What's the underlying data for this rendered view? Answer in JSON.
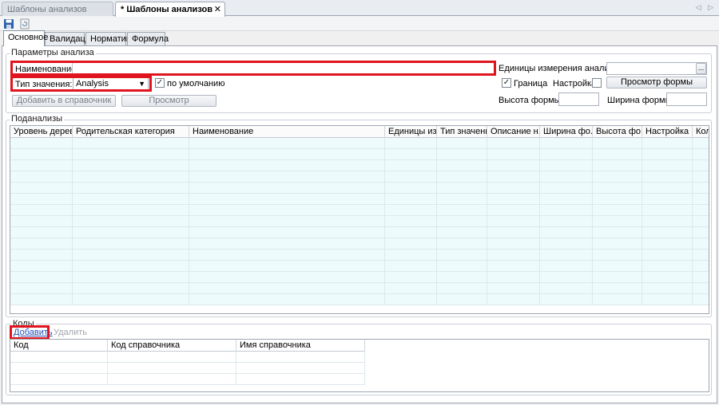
{
  "doc_tabs": {
    "inactive_title": "Шаблоны анализов",
    "active_title": "* Шаблоны анализов (нов...",
    "close_glyph": "✕",
    "scroll_glyph": "◁ ▷"
  },
  "toolbar": {
    "save_icon": "save-icon",
    "refresh_icon": "refresh-document-icon"
  },
  "form_tabs": [
    {
      "label": "Основное",
      "active": true
    },
    {
      "label": "Валидация",
      "active": false
    },
    {
      "label": "Норматив",
      "active": false
    },
    {
      "label": "Формула",
      "active": false
    }
  ],
  "params": {
    "group_title": "Параметры анализа",
    "name_label": "Наименование:",
    "name_value": "",
    "value_type_label": "Тип значения:",
    "value_type_selected": "Analysis",
    "default_label": "по умолчанию",
    "default_checked": true,
    "check_glyph": "✓",
    "add_to_dict_label": "Добавить в справочник",
    "preview_label": "Просмотр",
    "units_label": "Единицы измерения анализа:",
    "units_value": "",
    "units_browse": "...",
    "border_label": "Граница",
    "border_checked": true,
    "setting_label": "Настройка",
    "setting_checked": false,
    "form_preview_label": "Просмотр формы",
    "form_height_label": "Высота формы",
    "form_height_value": "",
    "form_width_label": "Ширина формы",
    "form_width_value": ""
  },
  "subanalyses": {
    "group_title": "Подaнализы",
    "columns": [
      "Уровень дерева",
      "Родительская категория",
      "Наименование",
      "Единицы из...",
      "Тип значения",
      "Описание н...",
      "Ширина фо...",
      "Высота фо...",
      "Настройка ...",
      "Кол"
    ],
    "rows": []
  },
  "codes": {
    "group_title": "Коды",
    "add_label": "Добавить",
    "delete_label": "Удалить",
    "columns": [
      "Код",
      "Код справочника",
      "Имя справочника"
    ],
    "rows": []
  },
  "colors": {
    "highlight": "#e0141e",
    "grid_bg": "#eefbfc",
    "link": "#1f4fb6"
  }
}
